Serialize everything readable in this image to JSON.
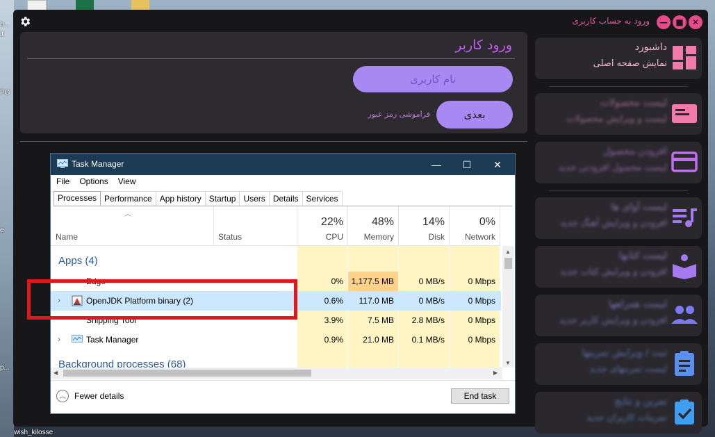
{
  "desktop": {
    "labels": [
      "h...",
      "it",
      "PG",
      "e",
      "p...",
      "wish_kilosse"
    ]
  },
  "app": {
    "title": "ورود به حساب کاربری",
    "window_buttons": [
      "—",
      "■",
      "✕"
    ],
    "login": {
      "title": "ورود کاربر",
      "username_placeholder": "نام کاربری",
      "next_label": "بعدی",
      "forgot_label": "فراموشی رمز عبور"
    },
    "sidebar": [
      {
        "title": "داشبورد",
        "subtitle": "نمایش صفحه اصلی",
        "icon": "dashboard-icon",
        "color": "#f07aa8"
      },
      {
        "title": "لیست محصولات",
        "subtitle": "لیست و ویرایش محصولات",
        "icon": "product-card-icon",
        "color": "#f07aa8"
      },
      {
        "title": "افزودن محصول",
        "subtitle": "لیست محصول افزودنی جدید",
        "icon": "credit-card-icon",
        "color": "#c06ef0"
      },
      {
        "title": "لیست آوای ها",
        "subtitle": "افزودن و ویرایش آهنگ جدید",
        "icon": "playlist-icon",
        "color": "#a57af0"
      },
      {
        "title": "لیست کتابها",
        "subtitle": "افزودن و ویرایش کتاب جدید",
        "icon": "book-reader-icon",
        "color": "#a57af0"
      },
      {
        "title": "لیست همراهها",
        "subtitle": "افزودن و ویرایش کاربر جدید",
        "icon": "people-icon",
        "color": "#7b7af0"
      },
      {
        "title": "ثبت / ویرایش تمرینها",
        "subtitle": "لیست تمرینهای جدید",
        "icon": "clipboard-icon",
        "color": "#5a8ef0"
      },
      {
        "title": "تمرین و نتایج",
        "subtitle": "تمرینات کاربران جدید",
        "icon": "clipboard-check-icon",
        "color": "#3f9ef0"
      }
    ]
  },
  "task_manager": {
    "title": "Task Manager",
    "controls": [
      "—",
      "☐",
      "✕"
    ],
    "menu": [
      "File",
      "Options",
      "View"
    ],
    "tabs": [
      "Processes",
      "Performance",
      "App history",
      "Startup",
      "Users",
      "Details",
      "Services"
    ],
    "selected_tab": "Processes",
    "columns": {
      "name": "Name",
      "status": "Status",
      "cpu": {
        "pct": "22%",
        "label": "CPU"
      },
      "memory": {
        "pct": "48%",
        "label": "Memory"
      },
      "disk": {
        "pct": "14%",
        "label": "Disk"
      },
      "network": {
        "pct": "0%",
        "label": "Network"
      }
    },
    "apps_section": "Apps (4)",
    "background_section": "Background processes (68)",
    "rows": [
      {
        "name": "Edge",
        "cpu": "0%",
        "memory": "1,177.5 MB",
        "disk": "0 MB/s",
        "network": "0 Mbps"
      },
      {
        "name": "OpenJDK Platform binary (2)",
        "cpu": "0.6%",
        "memory": "117.0 MB",
        "disk": "0 MB/s",
        "network": "0 Mbps"
      },
      {
        "name": "Snipping Tool",
        "cpu": "3.9%",
        "memory": "7.5 MB",
        "disk": "2.8 MB/s",
        "network": "0 Mbps"
      },
      {
        "name": "Task Manager",
        "cpu": "0.9%",
        "memory": "21.0 MB",
        "disk": "0.1 MB/s",
        "network": "0 Mbps"
      }
    ],
    "fewer_details": "Fewer details",
    "end_task": "End task",
    "highlight_color": "#e3161c"
  }
}
